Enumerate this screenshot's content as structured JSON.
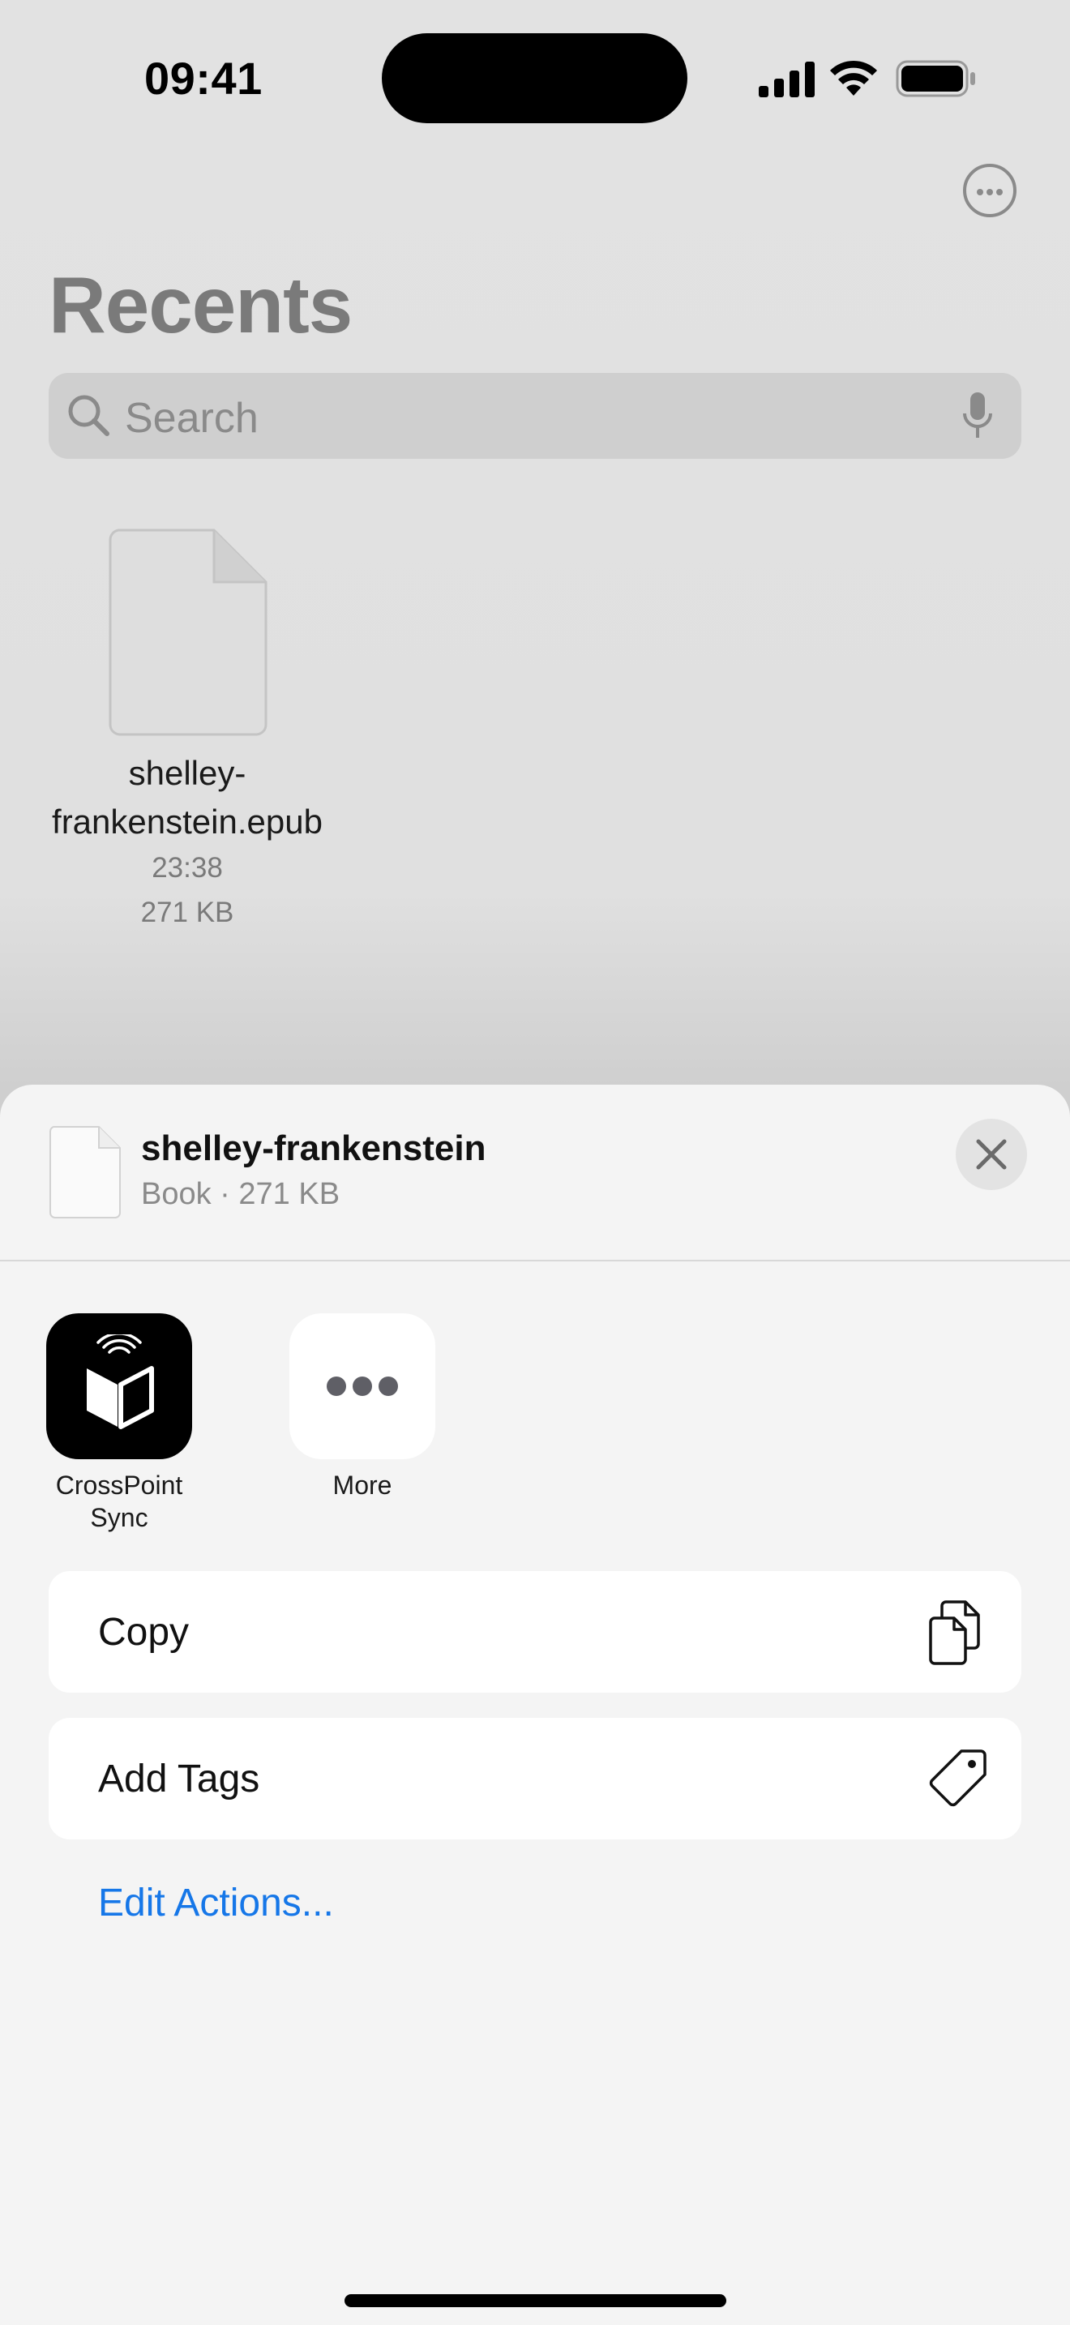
{
  "status_bar": {
    "time": "09:41"
  },
  "background": {
    "title": "Recents",
    "search": {
      "placeholder": "Search"
    },
    "file": {
      "name": "shelley-frankenstein.epub",
      "time": "23:38",
      "size": "271 KB"
    }
  },
  "share_sheet": {
    "title": "shelley-frankenstein",
    "subtitle": "Book · 271 KB",
    "apps": [
      {
        "label": "CrossPoint Sync",
        "icon": "crosspoint-sync-icon"
      },
      {
        "label": "More",
        "icon": "more-dots-icon"
      }
    ],
    "actions": [
      {
        "label": "Copy",
        "icon": "copy-icon"
      },
      {
        "label": "Add Tags",
        "icon": "tag-icon"
      }
    ],
    "edit_actions": "Edit Actions..."
  },
  "colors": {
    "link": "#1677e8",
    "sheet_background": "#f4f4f4",
    "dimmed_background": "#e0e0e0"
  }
}
